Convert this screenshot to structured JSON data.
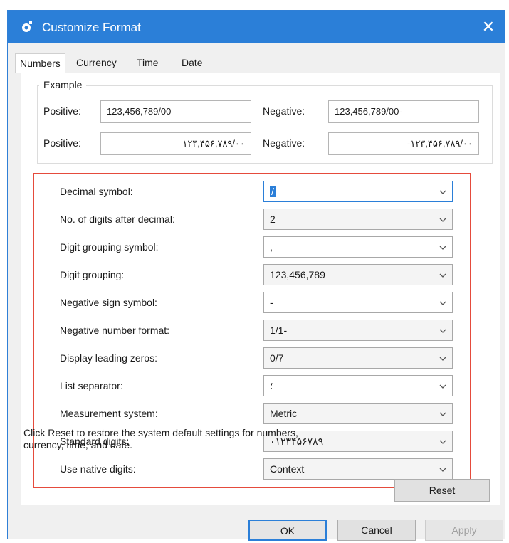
{
  "window": {
    "title": "Customize Format",
    "close_glyph": "✕",
    "accent_color": "#2b7fd8",
    "highlight_border_color": "#e54b3c"
  },
  "tabs": [
    {
      "label": "Numbers",
      "active": true
    },
    {
      "label": "Currency",
      "active": false
    },
    {
      "label": "Time",
      "active": false
    },
    {
      "label": "Date",
      "active": false
    }
  ],
  "example": {
    "group_label": "Example",
    "positive_label": "Positive:",
    "negative_label": "Negative:",
    "positive_value_1": "123,456,789/00",
    "negative_value_1": "123,456,789/00-",
    "positive_value_2": "۱۲۳,۴۵۶,۷۸۹/۰۰",
    "negative_value_2": "-۱۲۳,۴۵۶,۷۸۹/۰۰"
  },
  "settings": [
    {
      "label": "Decimal symbol:",
      "value": "/",
      "enabled": true,
      "focused": true
    },
    {
      "label": "No. of digits after decimal:",
      "value": "2",
      "enabled": false
    },
    {
      "label": "Digit grouping symbol:",
      "value": ",",
      "enabled": true
    },
    {
      "label": "Digit grouping:",
      "value": "123,456,789",
      "enabled": false
    },
    {
      "label": "Negative sign symbol:",
      "value": "-",
      "enabled": true
    },
    {
      "label": "Negative number format:",
      "value": "1/1-",
      "enabled": false
    },
    {
      "label": "Display leading zeros:",
      "value": "0/7",
      "enabled": false
    },
    {
      "label": "List separator:",
      "value": "؛",
      "enabled": true
    },
    {
      "label": "Measurement system:",
      "value": "Metric",
      "enabled": false
    },
    {
      "label": "Standard digits:",
      "value": "۰۱۲۳۴۵۶۷۸۹",
      "enabled": false
    },
    {
      "label": "Use native digits:",
      "value": "Context",
      "enabled": false
    }
  ],
  "footer": {
    "info_text": "Click Reset to restore the system default settings for numbers, currency, time, and date.",
    "reset_label": "Reset",
    "ok_label": "OK",
    "cancel_label": "Cancel",
    "apply_label": "Apply"
  }
}
